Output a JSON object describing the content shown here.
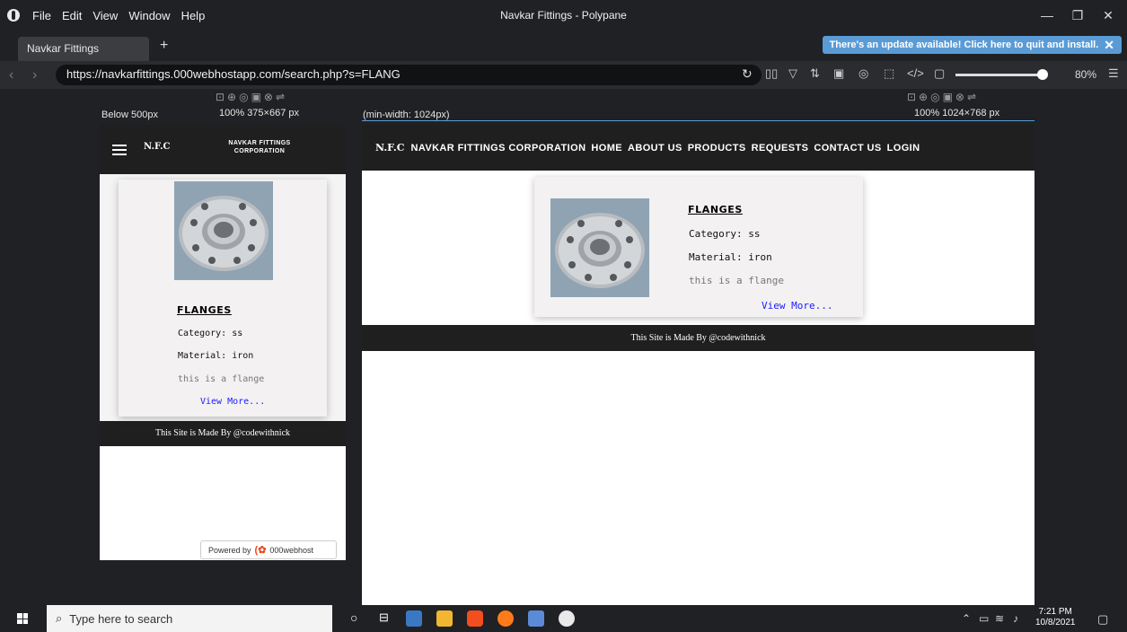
{
  "window": {
    "title": "Navkar Fittings - Polypane",
    "menu": [
      "File",
      "Edit",
      "View",
      "Window",
      "Help"
    ]
  },
  "tabs": [
    {
      "label": "Navkar Fittings"
    }
  ],
  "new_tab_label": "+",
  "update_banner": "There's an update available! Click here to quit and install.",
  "address": {
    "url": "https://navkarfittings.000webhostapp.com/search.php?s=FLANG",
    "zoom": "80%"
  },
  "panes": {
    "mobile": {
      "label": "Below 500px",
      "dims": "100%  375×667 px"
    },
    "desktop": {
      "label": "(min-width: 1024px)",
      "dims": "100%  1024×768 px"
    }
  },
  "site": {
    "brand": "N.F.C",
    "brand_full": "NAVKAR FITTINGS CORPORATION",
    "nav": [
      "NAVKAR FITTINGS CORPORATION",
      "HOME",
      "ABOUT US",
      "PRODUCTS",
      "REQUESTS",
      "CONTACT US",
      "LOGIN"
    ],
    "product": {
      "title": "FLANGES",
      "category": "Category: ss",
      "material": "Material: iron",
      "description": "this is a flange",
      "link": "View More..."
    },
    "footer": "This Site is Made By @codewithnick",
    "powered_by": "Powered by",
    "host": "000webhost"
  },
  "taskbar": {
    "search_placeholder": "Type here to search",
    "time": "7:21 PM",
    "date": "10/8/2021"
  },
  "colors": {
    "accent": "#5a9bd5",
    "nav_bg": "#1f1f1f",
    "link": "#1a1aff"
  }
}
